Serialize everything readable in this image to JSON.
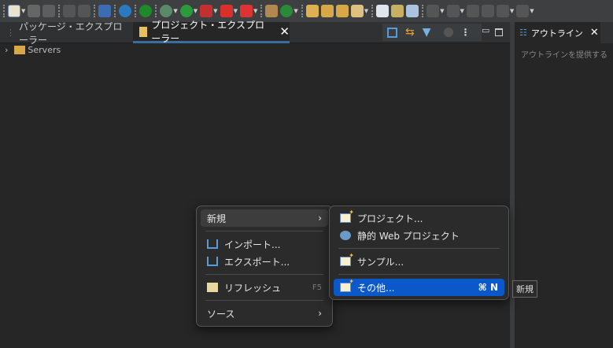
{
  "toolbar": {
    "icons": [
      "new-wizard-icon",
      "save-icon",
      "save-all-icon",
      "undo-icon",
      "redo-icon",
      "console-icon",
      "settings-icon",
      "power-icon",
      "debug-icon",
      "run-icon",
      "run-server-icon",
      "stop-icon",
      "publish-icon",
      "new-package-icon",
      "new-class-icon",
      "open-type-icon",
      "open-task-icon",
      "open-folder-icon",
      "search-icon",
      "new-web-icon",
      "new-jsp-icon",
      "new-servlet-icon",
      "next-annotation-icon",
      "prev-annotation-icon",
      "back-icon",
      "forward-icon",
      "nav-back-icon",
      "nav-forward-icon"
    ]
  },
  "tabs": [
    {
      "label": "パッケージ・エクスプローラー"
    },
    {
      "label": "プロジェクト・エクスプローラー"
    }
  ],
  "tree": [
    {
      "label": "Servers"
    }
  ],
  "outline": {
    "tab_label": "アウトライン",
    "message": "アウトラインを提供する"
  },
  "context_menu": {
    "items": [
      {
        "label": "新規"
      },
      {
        "label": "インポート..."
      },
      {
        "label": "エクスポート..."
      },
      {
        "label": "リフレッシュ",
        "shortcut": "F5"
      },
      {
        "label": "ソース"
      }
    ]
  },
  "submenu": {
    "items": [
      {
        "label": "プロジェクト..."
      },
      {
        "label": "静的 Web プロジェクト"
      },
      {
        "label": "サンプル..."
      },
      {
        "label": "その他...",
        "shortcut": "⌘ N"
      }
    ]
  },
  "tooltip": "新規",
  "colors": {
    "selection": "#0a58ca",
    "tab_underline": "#3a6e9f"
  }
}
